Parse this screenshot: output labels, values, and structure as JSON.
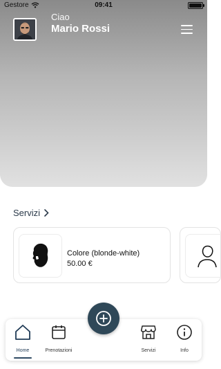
{
  "status_bar": {
    "carrier": "Gestore",
    "time": "09:41"
  },
  "header": {
    "greeting": "Ciao",
    "user_name": "Mario Rossi"
  },
  "services_section": {
    "title": "Servizi"
  },
  "services": [
    {
      "name": "Colore (blonde-white)",
      "price": "50.00 €"
    }
  ],
  "tab_bar": {
    "tabs": [
      {
        "label": "Home",
        "active": true
      },
      {
        "label": "Prenotazioni",
        "active": false
      },
      {
        "label": "Servizi",
        "active": false
      },
      {
        "label": "Info",
        "active": false
      }
    ]
  },
  "colors": {
    "primary": "#2f4858",
    "header_top": "#8a8a8a",
    "header_bottom": "#e1e1e1"
  },
  "icons": [
    "wifi-icon",
    "battery-icon",
    "avatar",
    "menu-icon",
    "chevron-right-icon",
    "beard-silhouette-icon",
    "person-outline-icon",
    "home-icon",
    "calendar-icon",
    "store-icon",
    "info-icon",
    "plus-circle-icon"
  ]
}
